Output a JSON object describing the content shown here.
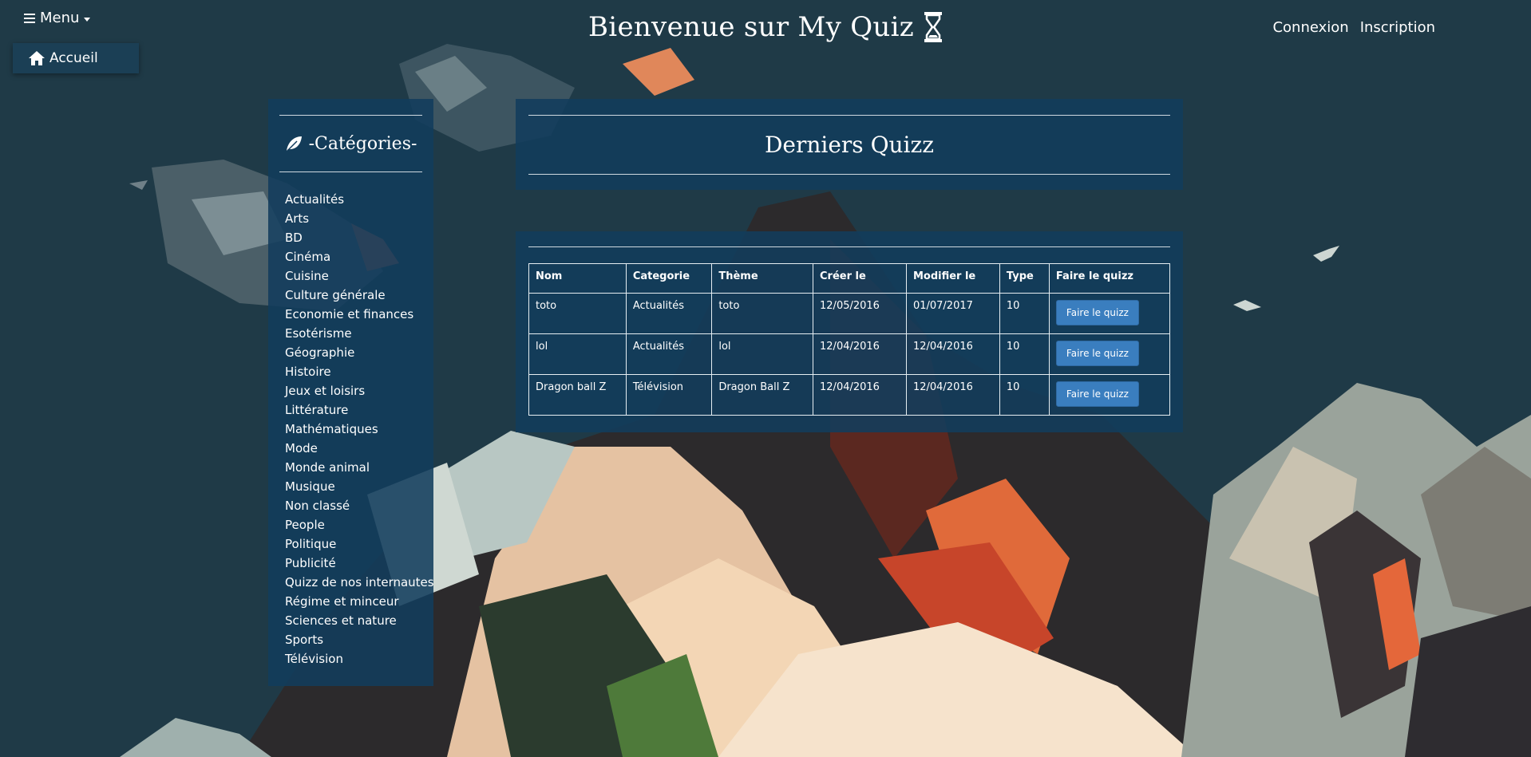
{
  "header": {
    "menu_label": "Menu",
    "home_label": "Accueil",
    "site_title": "Bienvenue sur My Quiz",
    "login_label": "Connexion",
    "signup_label": "Inscription"
  },
  "categories": {
    "title": "-Catégories-",
    "items": [
      "Actualités",
      "Arts",
      "BD",
      "Cinéma",
      "Cuisine",
      "Culture générale",
      "Economie et finances",
      "Esotérisme",
      "Géographie",
      "Histoire",
      "Jeux et loisirs",
      "Littérature",
      "Mathématiques",
      "Mode",
      "Monde animal",
      "Musique",
      "Non classé",
      "People",
      "Politique",
      "Publicité",
      "Quizz de nos internautes",
      "Régime et minceur",
      "Sciences et nature",
      "Sports",
      "Télévision"
    ]
  },
  "recent": {
    "title": "Derniers Quizz"
  },
  "table": {
    "headers": [
      "Nom",
      "Categorie",
      "Thème",
      "Créer le",
      "Modifier le",
      "Type",
      "Faire le quizz"
    ],
    "rows": [
      [
        "toto",
        "Actualités",
        "toto",
        "12/05/2016",
        "01/07/2017",
        "10"
      ],
      [
        "lol",
        "Actualités",
        "lol",
        "12/04/2016",
        "12/04/2016",
        "10"
      ],
      [
        "Dragon ball Z",
        "Télévision",
        "Dragon Ball Z",
        "12/04/2016",
        "12/04/2016",
        "10"
      ]
    ],
    "action_label": "Faire le quizz"
  },
  "colors": {
    "panel": "#123c5c",
    "button": "#3a7ebf",
    "background": "#1f3a47"
  }
}
